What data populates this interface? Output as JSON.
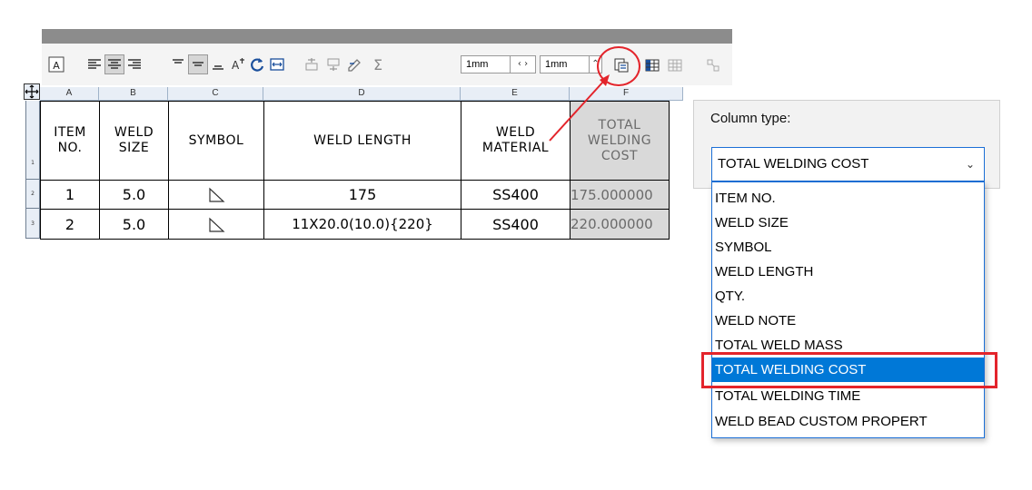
{
  "toolbar": {
    "spacing_value_1": "1mm",
    "spacing_value_2": "1mm",
    "spin_1": "‹ ›",
    "spin_2": "⌃"
  },
  "columns": [
    "A",
    "B",
    "C",
    "D",
    "E",
    "F"
  ],
  "row_numbers": [
    "1",
    "2",
    "3"
  ],
  "table": {
    "headers": [
      [
        "ITEM",
        "NO."
      ],
      [
        "WELD",
        "SIZE"
      ],
      [
        "SYMBOL"
      ],
      [
        "WELD LENGTH"
      ],
      [
        "WELD",
        "MATERIAL"
      ],
      [
        "TOTAL",
        "WELDING",
        "COST"
      ]
    ],
    "rows": [
      {
        "item": "1",
        "size": "5.0",
        "length": "175",
        "material": "SS400",
        "cost": "175.000000"
      },
      {
        "item": "2",
        "size": "5.0",
        "length": "11X20.0(10.0){220}",
        "material": "SS400",
        "cost": "220.000000"
      }
    ]
  },
  "column_type": {
    "label": "Column type:",
    "selected": "TOTAL WELDING COST",
    "options": [
      "ITEM NO.",
      "WELD SIZE",
      "SYMBOL",
      "WELD LENGTH",
      "QTY.",
      "WELD NOTE",
      "TOTAL WELD MASS",
      "TOTAL WELDING COST",
      "TOTAL WELDING TIME",
      "WELD BEAD CUSTOM PROPERT"
    ]
  },
  "colors": {
    "accent": "#0078d7",
    "highlight_red": "#e3242b",
    "header_gray": "#8c8c8c"
  }
}
